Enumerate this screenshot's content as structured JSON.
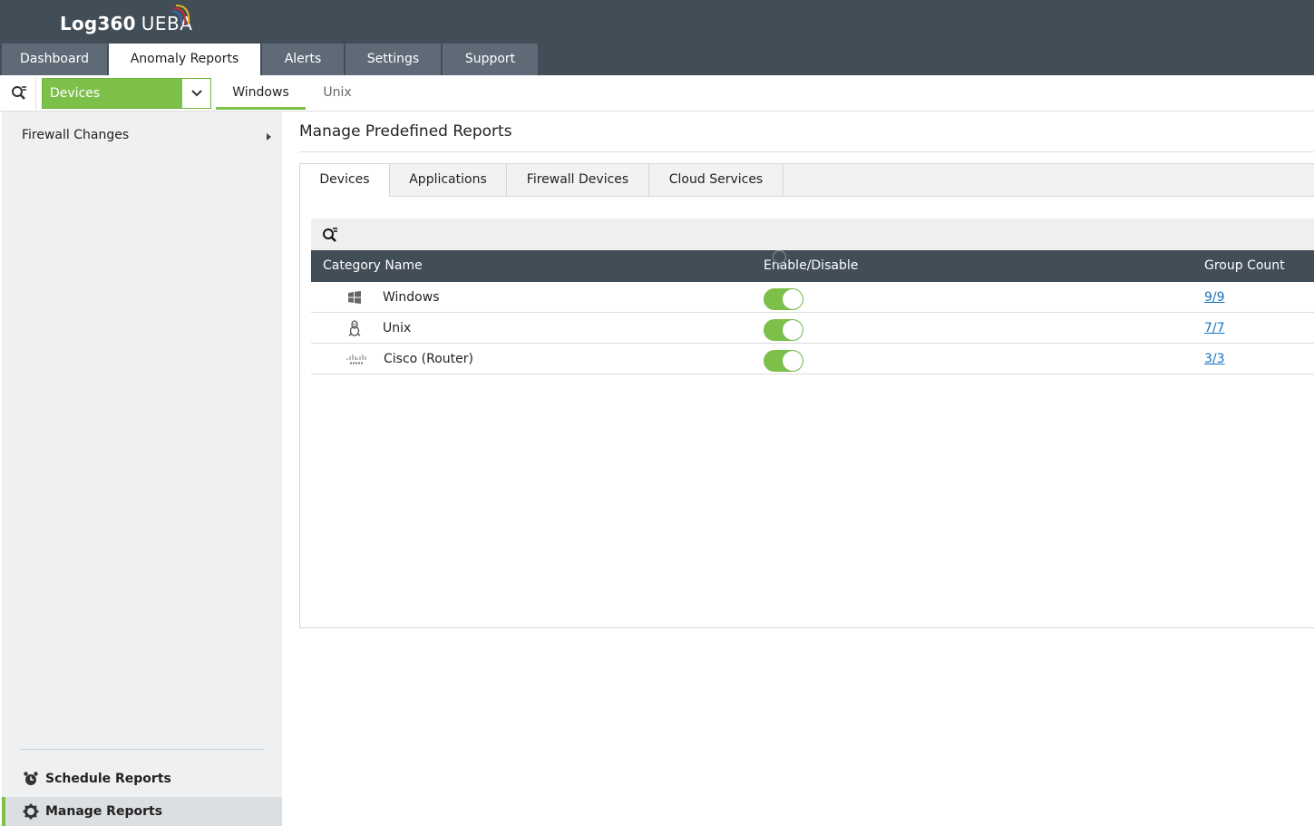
{
  "app": {
    "logo_main": "Log360",
    "logo_sub": "UEBA"
  },
  "main_tabs": [
    {
      "label": "Dashboard"
    },
    {
      "label": "Anomaly Reports"
    },
    {
      "label": "Alerts"
    },
    {
      "label": "Settings"
    },
    {
      "label": "Support"
    }
  ],
  "subbar": {
    "device_select": "Devices",
    "tabs": [
      {
        "label": "Windows"
      },
      {
        "label": "Unix"
      }
    ]
  },
  "sidebar": {
    "items": [
      {
        "label": "Firewall Changes"
      }
    ],
    "schedule_reports": "Schedule Reports",
    "manage_reports": "Manage Reports"
  },
  "main": {
    "title": "Manage Predefined Reports",
    "tabs": [
      {
        "label": "Devices"
      },
      {
        "label": "Applications"
      },
      {
        "label": "Firewall Devices"
      },
      {
        "label": "Cloud Services"
      }
    ],
    "table": {
      "headers": {
        "category": "Category Name",
        "enable": "Enable/Disable",
        "help": "?",
        "count": "Group Count"
      },
      "rows": [
        {
          "icon": "windows-icon",
          "name": "Windows",
          "enabled": true,
          "count": "9/9"
        },
        {
          "icon": "linux-icon",
          "name": "Unix",
          "enabled": true,
          "count": "7/7"
        },
        {
          "icon": "cisco-icon",
          "name": "Cisco (Router)",
          "enabled": true,
          "count": "3/3"
        }
      ]
    }
  },
  "colors": {
    "header": "#414d57",
    "tab": "#5e6b76",
    "accent": "#7cc04a",
    "link": "#1a73c1",
    "sidebar": "#eef0f2"
  }
}
